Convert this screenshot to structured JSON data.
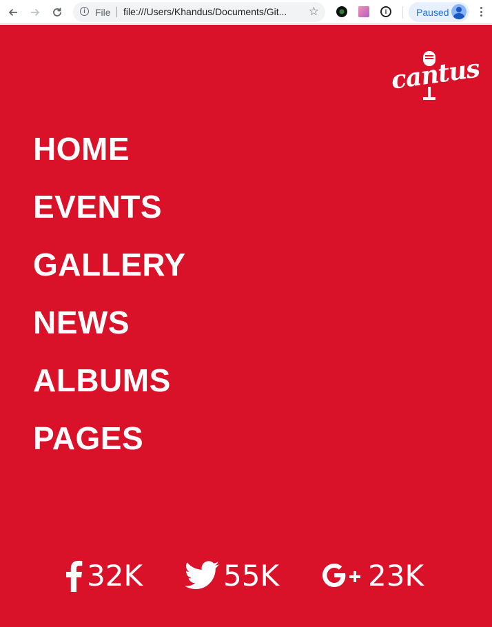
{
  "browser": {
    "scheme_label": "File",
    "url": "file:///Users/Khandus/Documents/Git...",
    "profile_status": "Paused",
    "icons": {
      "back": "back-arrow-icon",
      "forward": "forward-arrow-icon",
      "reload": "reload-icon",
      "info": "info-icon",
      "bookmark": "star-icon",
      "menu": "more-vert-icon"
    }
  },
  "site": {
    "logo_text": "cantus",
    "accent_color": "#d9122a",
    "menu": [
      {
        "label": "HOME"
      },
      {
        "label": "EVENTS"
      },
      {
        "label": "GALLERY"
      },
      {
        "label": "NEWS"
      },
      {
        "label": "ALBUMS"
      },
      {
        "label": "PAGES"
      }
    ],
    "social": [
      {
        "network": "facebook",
        "icon": "facebook-icon",
        "count": "32K"
      },
      {
        "network": "twitter",
        "icon": "twitter-icon",
        "count": "55K"
      },
      {
        "network": "google-plus",
        "icon": "google-plus-icon",
        "count": "23K"
      }
    ]
  }
}
